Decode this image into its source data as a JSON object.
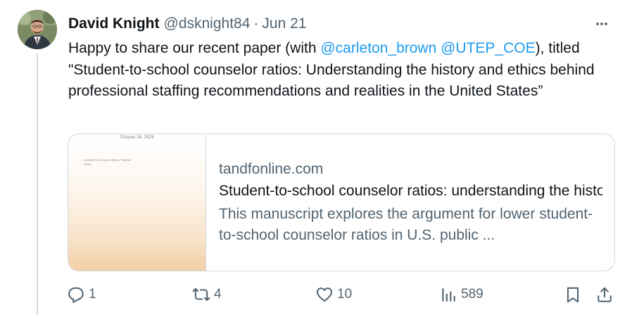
{
  "author": {
    "display_name": "David Knight",
    "handle": "@dsknight84",
    "separator": "·",
    "date": "Jun 21"
  },
  "tweet": {
    "text_before": "Happy to share our recent paper (with ",
    "mention_1": "@carleton_brown",
    "mention_2": "@UTEP_COE",
    "text_after": "), titled \"Student-to-school counselor ratios: Understanding the history and ethics behind professional staffing recommendations and realities in the United States”"
  },
  "card": {
    "thumbnail_volume": "Volume 34, 2024",
    "thumbnail_note": "Included in the print edition: Number 3/July",
    "domain": "tandfonline.com",
    "title": "Student-to-school counselor ratios: understanding the history and ethics behind professional staffing recommendations and realities in the United States",
    "description": "This manuscript explores the argument for lower student-to-school counselor ratios in U.S. public ..."
  },
  "actions": {
    "replies": "1",
    "reposts": "4",
    "likes": "10",
    "views": "589"
  },
  "icons": {
    "more": "more-icon",
    "reply": "reply-icon",
    "repost": "repost-icon",
    "like": "heart-icon",
    "views": "views-icon",
    "bookmark": "bookmark-icon",
    "share": "share-icon"
  },
  "colors": {
    "link": "#1d9bf0",
    "secondary_text": "#536471",
    "primary_text": "#0f1419",
    "border": "#cfd9de"
  }
}
